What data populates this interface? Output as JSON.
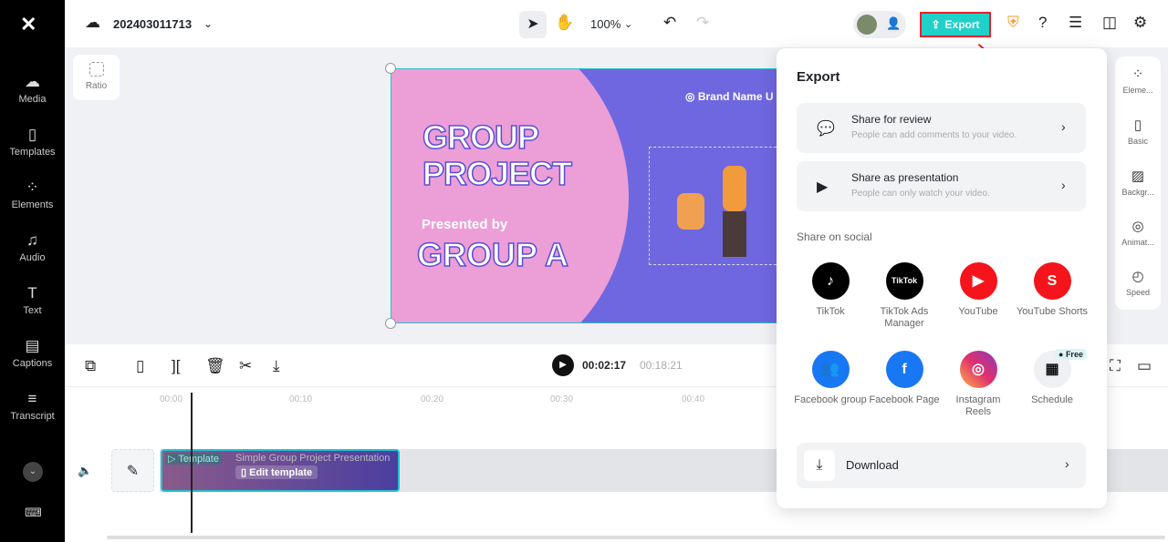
{
  "sidebar": {
    "items": [
      {
        "label": "Media",
        "icon": "cloud-upload-icon"
      },
      {
        "label": "Templates",
        "icon": "templates-icon"
      },
      {
        "label": "Elements",
        "icon": "elements-icon"
      },
      {
        "label": "Audio",
        "icon": "music-icon"
      },
      {
        "label": "Text",
        "icon": "text-icon"
      },
      {
        "label": "Captions",
        "icon": "captions-icon"
      },
      {
        "label": "Transcript",
        "icon": "transcript-icon"
      }
    ]
  },
  "header": {
    "project_name": "202403011713",
    "zoom": "100%",
    "export_label": "Export"
  },
  "canvas": {
    "ratio_label": "Ratio",
    "title_line1": "GROUP",
    "title_line2": "PROJECT",
    "presented_by": "Presented by",
    "group": "GROUP A",
    "brand": "Brand Name U"
  },
  "right_panel": {
    "items": [
      "Eleme...",
      "Basic",
      "Backgr...",
      "Animat...",
      "Speed"
    ]
  },
  "player": {
    "current": "00:02:17",
    "total": "00:18:21"
  },
  "timeline": {
    "ticks": [
      "00:00",
      "00:10",
      "00:20",
      "00:30",
      "00:40"
    ],
    "clip_tag": "Template",
    "clip_title": "Simple Group Project Presentation",
    "edit_label": "Edit template"
  },
  "export_popup": {
    "title": "Export",
    "share_review": {
      "title": "Share for review",
      "desc": "People can add comments to your video."
    },
    "share_presentation": {
      "title": "Share as presentation",
      "desc": "People can only watch your video."
    },
    "social_heading": "Share on social",
    "social": [
      {
        "label": "TikTok",
        "color": "#000000"
      },
      {
        "label": "TikTok Ads Manager",
        "color": "#000000"
      },
      {
        "label": "YouTube",
        "color": "#f5141b"
      },
      {
        "label": "YouTube Shorts",
        "color": "#f5141b"
      },
      {
        "label": "Facebook group",
        "color": "#1877f2"
      },
      {
        "label": "Facebook Page",
        "color": "#1877f2"
      },
      {
        "label": "Instagram Reels",
        "color": "#e1306c"
      },
      {
        "label": "Schedule",
        "color": "#eef0f3"
      }
    ],
    "free_badge": "Free",
    "download_label": "Download"
  },
  "colors": {
    "accent": "#1fd1c8",
    "highlight": "#e8202a"
  }
}
